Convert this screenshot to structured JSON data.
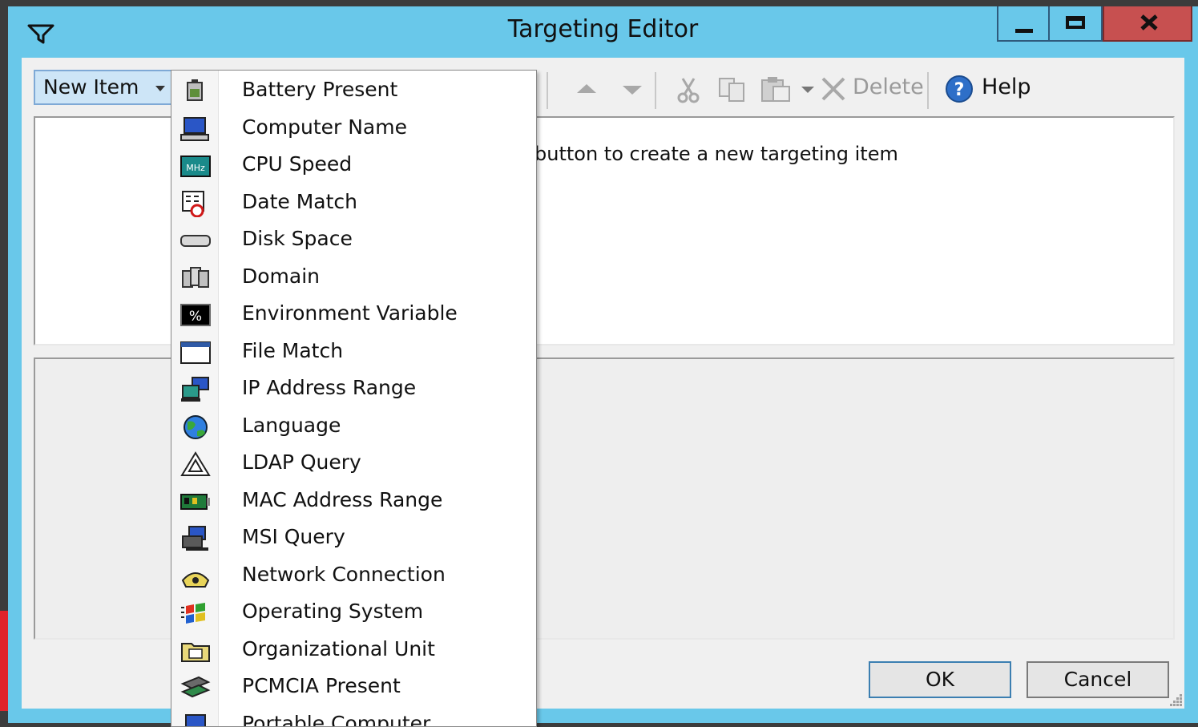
{
  "window": {
    "title": "Targeting Editor",
    "minimize_label": "Minimize",
    "maximize_label": "Maximize",
    "close_label": "Close"
  },
  "toolbar": {
    "new_item_label": "New Item",
    "delete_label": "Delete",
    "help_label": "Help"
  },
  "main": {
    "hint_text": "button to create a new targeting item"
  },
  "buttons": {
    "ok_label": "OK",
    "cancel_label": "Cancel"
  },
  "menu": {
    "items": [
      {
        "label": "Battery Present",
        "icon": "battery-icon"
      },
      {
        "label": "Computer Name",
        "icon": "computer-icon"
      },
      {
        "label": "CPU Speed",
        "icon": "cpu-icon"
      },
      {
        "label": "Date Match",
        "icon": "calendar-icon"
      },
      {
        "label": "Disk Space",
        "icon": "disk-icon"
      },
      {
        "label": "Domain",
        "icon": "domain-icon"
      },
      {
        "label": "Environment Variable",
        "icon": "environment-icon"
      },
      {
        "label": "File Match",
        "icon": "file-icon"
      },
      {
        "label": "IP Address Range",
        "icon": "network-computers-icon"
      },
      {
        "label": "Language",
        "icon": "globe-icon"
      },
      {
        "label": "LDAP Query",
        "icon": "triangle-icon"
      },
      {
        "label": "MAC Address Range",
        "icon": "network-card-icon"
      },
      {
        "label": "MSI Query",
        "icon": "msi-icon"
      },
      {
        "label": "Network Connection",
        "icon": "phone-icon"
      },
      {
        "label": "Operating System",
        "icon": "windows-flag-icon"
      },
      {
        "label": "Organizational Unit",
        "icon": "folder-icon"
      },
      {
        "label": "PCMCIA Present",
        "icon": "pcmcia-icon"
      },
      {
        "label": "Portable Computer",
        "icon": "laptop-icon"
      }
    ]
  },
  "colors": {
    "titlebar": "#69c8ea",
    "close_button": "#c75050",
    "new_item_bg": "#cde5f7"
  }
}
